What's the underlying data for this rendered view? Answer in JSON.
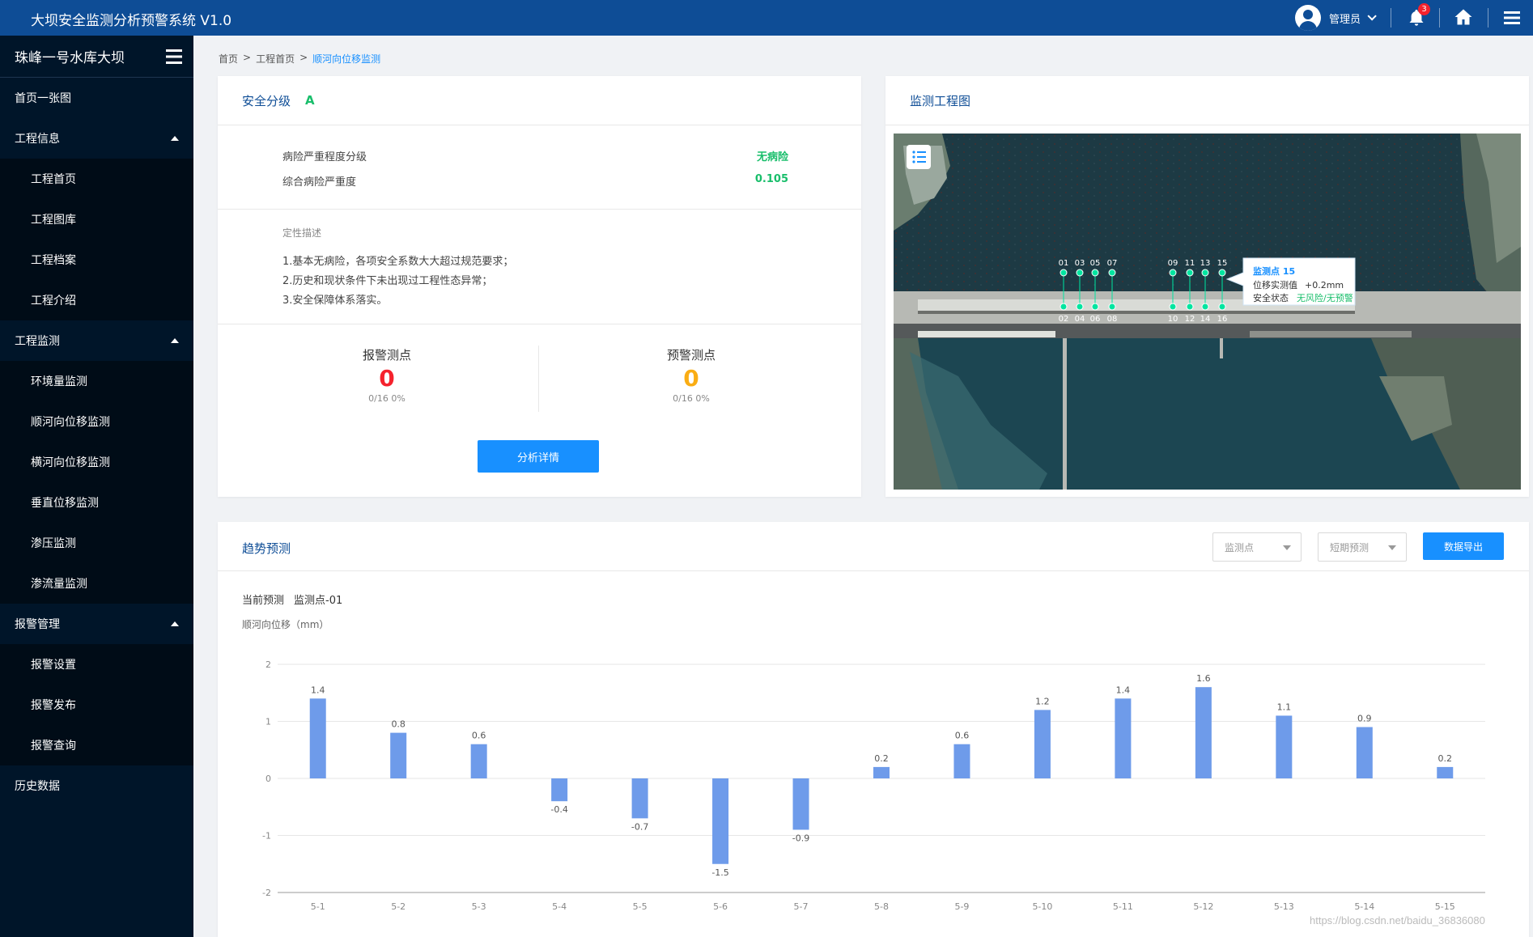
{
  "topbar": {
    "title": "大坝安全监测分析预警系统 V1.0",
    "user_name": "管理员",
    "notification_count": "3"
  },
  "sidebar": {
    "dam_name": "珠峰一号水库大坝",
    "items": [
      {
        "label": "首页一张图",
        "type": "parent",
        "expanded": false
      },
      {
        "label": "工程信息",
        "type": "parent",
        "expanded": true
      },
      {
        "label": "工程首页",
        "type": "child"
      },
      {
        "label": "工程图库",
        "type": "child"
      },
      {
        "label": "工程档案",
        "type": "child"
      },
      {
        "label": "工程介绍",
        "type": "child"
      },
      {
        "label": "工程监测",
        "type": "parent",
        "expanded": true
      },
      {
        "label": "环境量监测",
        "type": "child"
      },
      {
        "label": "顺河向位移监测",
        "type": "child"
      },
      {
        "label": "横河向位移监测",
        "type": "child"
      },
      {
        "label": "垂直位移监测",
        "type": "child"
      },
      {
        "label": "渗压监测",
        "type": "child"
      },
      {
        "label": "渗流量监测",
        "type": "child"
      },
      {
        "label": "报警管理",
        "type": "parent",
        "expanded": true
      },
      {
        "label": "报警设置",
        "type": "child"
      },
      {
        "label": "报警发布",
        "type": "child"
      },
      {
        "label": "报警查询",
        "type": "child"
      },
      {
        "label": "历史数据",
        "type": "parent",
        "expanded": false
      }
    ]
  },
  "breadcrumb": {
    "items": [
      "首页",
      "工程首页",
      "顺河向位移监测"
    ],
    "separator": ">"
  },
  "safety": {
    "title": "安全分级",
    "grade": "A",
    "rows": [
      {
        "label": "病险严重程度分级",
        "value": "无病险"
      },
      {
        "label": "综合病险严重度",
        "value": "0.105"
      }
    ],
    "desc_title": "定性描述",
    "desc_lines": [
      "1.基本无病险，各项安全系数大大超过规范要求；",
      "2.历史和现状条件下未出现过工程性态异常；",
      "3.安全保障体系落实。"
    ],
    "alarm": {
      "label": "报警测点",
      "value": "0",
      "sub": "0/16  0%",
      "color": "#f5222d"
    },
    "warn": {
      "label": "预警测点",
      "value": "0",
      "sub": "0/16  0%",
      "color": "#faad14"
    },
    "button_label": "分析详情"
  },
  "map": {
    "title": "监测工程图",
    "points_top": [
      "01",
      "03",
      "05",
      "07",
      "09",
      "11",
      "13",
      "15"
    ],
    "points_bottom": [
      "02",
      "04",
      "06",
      "08",
      "10",
      "12",
      "14",
      "16"
    ],
    "popup": {
      "title": "监测点 15",
      "label1": "位移实测值",
      "value1": "+0.2mm",
      "label2": "安全状态",
      "value2": "无风险/无预警"
    }
  },
  "trend": {
    "title": "趋势预测",
    "select1": "监测点",
    "select2": "短期预测",
    "export_label": "数据导出",
    "current_label": "当前预测",
    "current_point": "监测点-01",
    "ylabel": "顺河向位移（mm）"
  },
  "chart_data": {
    "type": "bar",
    "categories": [
      "5-1",
      "5-2",
      "5-3",
      "5-4",
      "5-5",
      "5-6",
      "5-7",
      "5-8",
      "5-9",
      "5-10",
      "5-11",
      "5-12",
      "5-13",
      "5-14",
      "5-15"
    ],
    "values": [
      1.4,
      0.8,
      0.6,
      -0.4,
      -0.7,
      -1.5,
      -0.9,
      0.2,
      0.6,
      1.2,
      1.4,
      1.6,
      1.1,
      0.9,
      0.2
    ],
    "ylim": [
      -2,
      2
    ],
    "yticks": [
      2,
      1,
      0,
      -1,
      -2
    ],
    "bar_color": "#6e9bea",
    "grid": true,
    "title": "",
    "xlabel": "",
    "ylabel": "顺河向位移（mm）"
  },
  "watermark": "https://blog.csdn.net/baidu_36836080"
}
